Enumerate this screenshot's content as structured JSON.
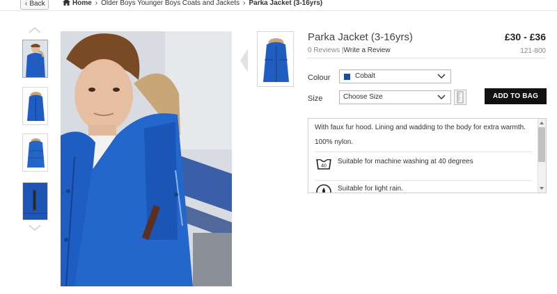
{
  "nav": {
    "back_label": "Back",
    "breadcrumbs": [
      "Home",
      "Older Boys Younger Boys Coats and Jackets",
      "Parka Jacket (3-16yrs)"
    ]
  },
  "product": {
    "title": "Parka Jacket (3-16yrs)",
    "price": "£30 - £36",
    "reviews_label": "0 Reviews",
    "separator": "|",
    "write_review_label": "Write a Review",
    "code": "121-800"
  },
  "options": {
    "colour_label": "Colour",
    "colour_value": "Cobalt",
    "size_label": "Size",
    "size_value": "Choose Size",
    "add_to_bag_label": "ADD TO BAG"
  },
  "description": {
    "line1": "With faux fur hood. Lining and wadding to the body for extra warmth.",
    "line2": "100% nylon.",
    "care1": "Suitable for machine washing at 40 degrees",
    "care2": "Suitable for light rain."
  },
  "colors": {
    "cobalt": "#1f4e96",
    "button_bg": "#111111"
  },
  "icons": [
    "home-icon",
    "chevron-left-icon",
    "chevron-right-icon",
    "chevron-down-icon",
    "wash-40-icon",
    "rain-icon",
    "size-guide-icon"
  ]
}
